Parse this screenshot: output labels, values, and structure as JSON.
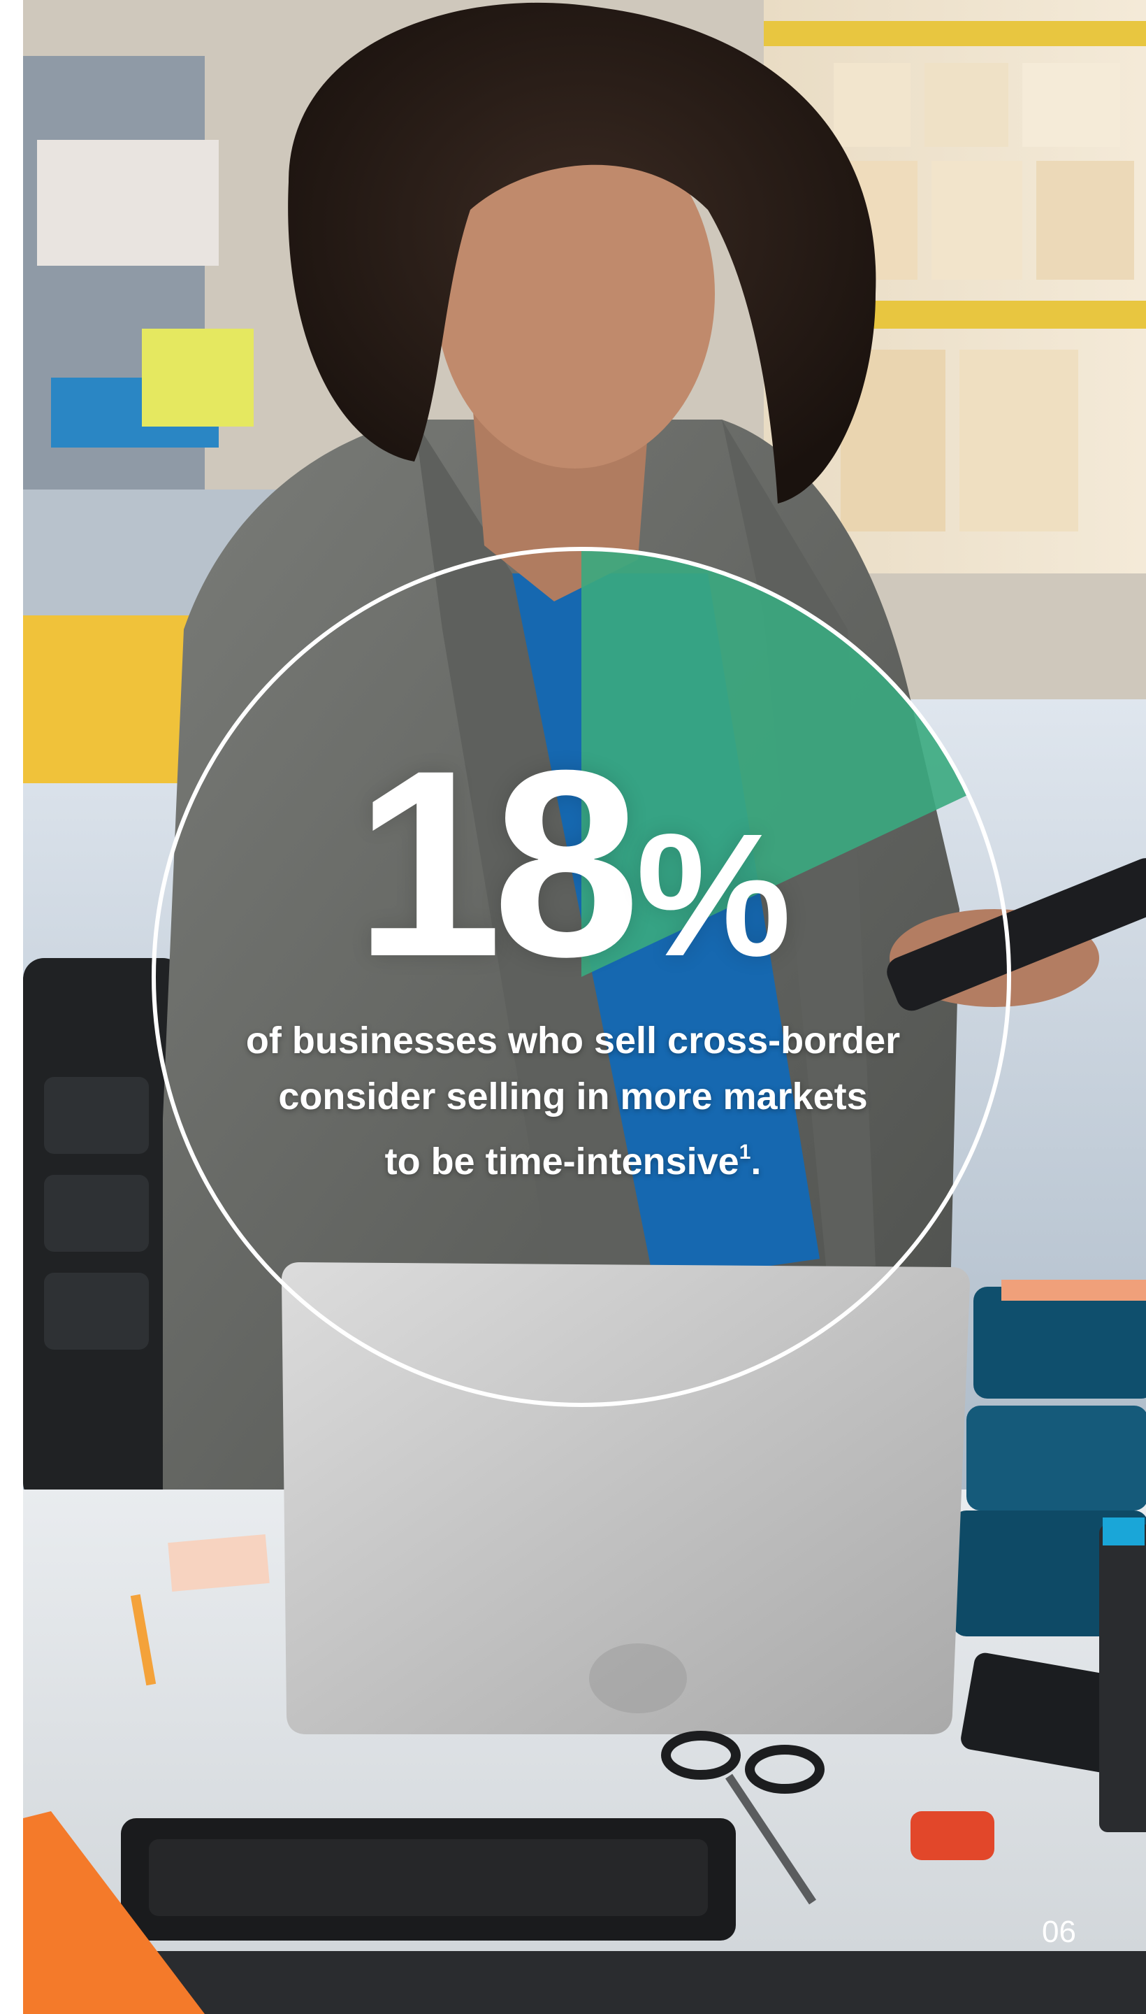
{
  "stat": {
    "value_digits": "18",
    "value_symbol": "%",
    "percent_value": 18
  },
  "caption": {
    "line1": "of businesses who sell cross-border",
    "line2": "consider selling in more markets",
    "line3": "to be time-intensive",
    "footnote_marker": "1",
    "trailing_punctuation": "."
  },
  "page_number": "06",
  "colors": {
    "accent_green": "#3aaa80",
    "ring_white": "#ffffff",
    "text_white": "#ffffff",
    "left_margin": "#ffffff"
  }
}
